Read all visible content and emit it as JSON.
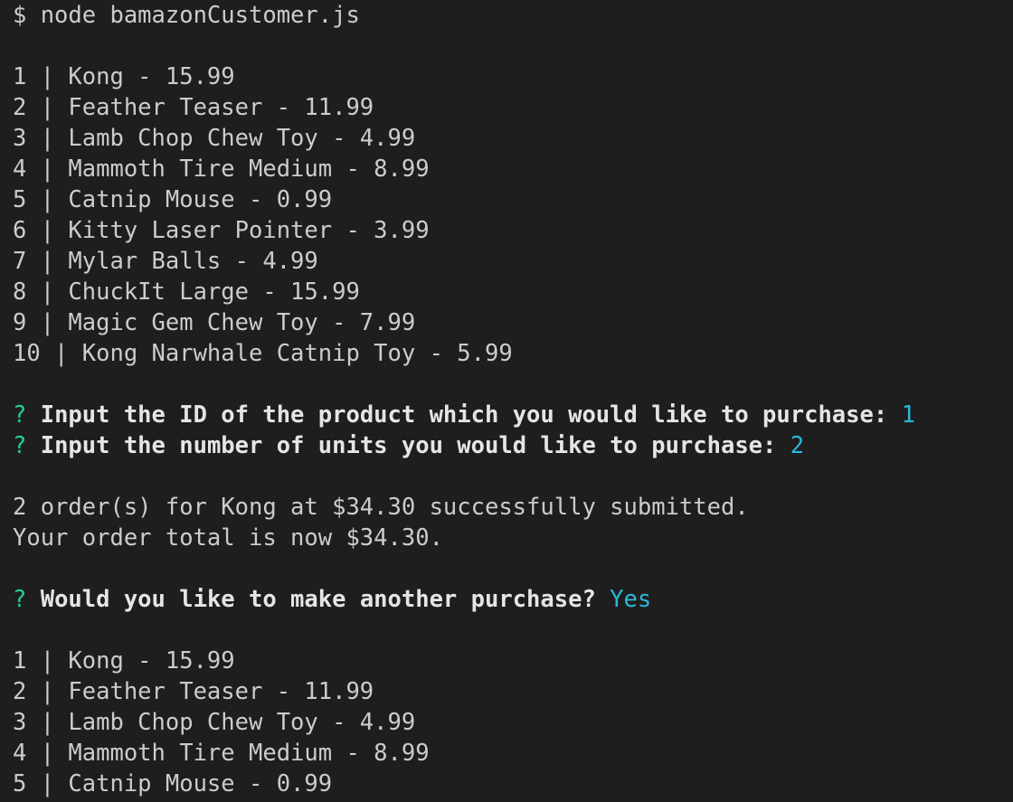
{
  "colors": {
    "background": "#1e1e1e",
    "text": "#cccccc",
    "prompt_marker": "#23d18b",
    "answer": "#29b8db"
  },
  "command": "$ node bamazonCustomer.js",
  "product_list_1": [
    "1 | Kong - 15.99",
    "2 | Feather Teaser - 11.99",
    "3 | Lamb Chop Chew Toy - 4.99",
    "4 | Mammoth Tire Medium - 8.99",
    "5 | Catnip Mouse - 0.99",
    "6 | Kitty Laser Pointer - 3.99",
    "7 | Mylar Balls - 4.99",
    "8 | ChuckIt Large - 15.99",
    "9 | Magic Gem Chew Toy - 7.99",
    "10 | Kong Narwhale Catnip Toy - 5.99"
  ],
  "prompts": [
    {
      "marker": "?",
      "question": "Input the ID of the product which you would like to purchase:",
      "answer": "1"
    },
    {
      "marker": "?",
      "question": "Input the number of units you would like to purchase:",
      "answer": "2"
    }
  ],
  "order_messages": [
    "2 order(s) for Kong at $34.30 successfully submitted.",
    "Your order total is now $34.30."
  ],
  "another_prompt": {
    "marker": "?",
    "question": "Would you like to make another purchase?",
    "answer": "Yes"
  },
  "product_list_2": [
    "1 | Kong - 15.99",
    "2 | Feather Teaser - 11.99",
    "3 | Lamb Chop Chew Toy - 4.99",
    "4 | Mammoth Tire Medium - 8.99",
    "5 | Catnip Mouse - 0.99"
  ]
}
